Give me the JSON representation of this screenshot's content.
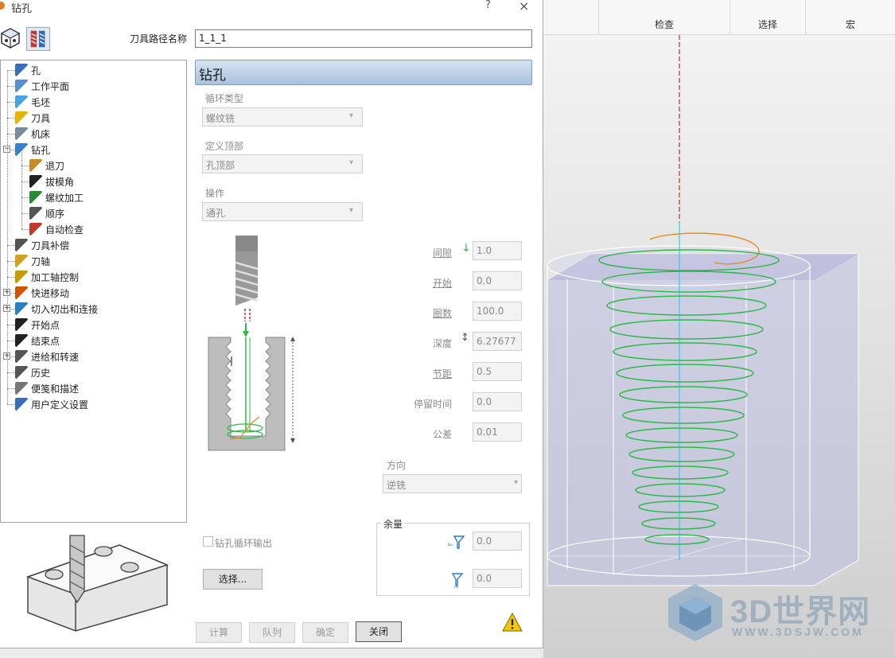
{
  "dialog": {
    "title": "钻孔",
    "help": "?",
    "close": "×",
    "path_label": "刀具路径名称",
    "path_value": "1_1_1"
  },
  "tree": [
    {
      "label": "孔",
      "icon": "hole-icon"
    },
    {
      "label": "工作平面",
      "icon": "workplane-icon"
    },
    {
      "label": "毛坯",
      "icon": "block-icon"
    },
    {
      "label": "刀具",
      "icon": "tool-icon"
    },
    {
      "label": "机床",
      "icon": "machine-icon"
    },
    {
      "label": "钻孔",
      "icon": "drill-icon"
    },
    {
      "label": "退刀",
      "icon": "retract-icon"
    },
    {
      "label": "拔模角",
      "icon": "draft-angle-icon"
    },
    {
      "label": "螺纹加工",
      "icon": "thread-icon"
    },
    {
      "label": "顺序",
      "icon": "order-icon"
    },
    {
      "label": "自动检查",
      "icon": "auto-check-icon"
    },
    {
      "label": "刀具补偿",
      "icon": "tool-comp-icon"
    },
    {
      "label": "刀轴",
      "icon": "tool-axis-icon"
    },
    {
      "label": "加工轴控制",
      "icon": "axis-control-icon"
    },
    {
      "label": "快进移动",
      "icon": "rapid-move-icon"
    },
    {
      "label": "切入切出和连接",
      "icon": "leads-links-icon"
    },
    {
      "label": "开始点",
      "icon": "start-point-icon"
    },
    {
      "label": "结束点",
      "icon": "end-point-icon"
    },
    {
      "label": "进给和转速",
      "icon": "feeds-speeds-icon"
    },
    {
      "label": "历史",
      "icon": "history-icon"
    },
    {
      "label": "便笺和描述",
      "icon": "notes-icon"
    },
    {
      "label": "用户定义设置",
      "icon": "user-settings-icon"
    }
  ],
  "section": {
    "title": "钻孔",
    "cycle_type_label": "循环类型",
    "cycle_type_value": "螺纹铣",
    "define_top_label": "定义顶部",
    "define_top_value": "孔顶部",
    "operation_label": "操作",
    "operation_value": "通孔"
  },
  "params": {
    "clearance_label": "间隙",
    "clearance_value": "1.0",
    "start_label": "开始",
    "start_value": "0.0",
    "turns_label": "圈数",
    "turns_value": "100.0",
    "depth_label": "深度",
    "depth_value": "6.27677",
    "pitch_label": "节距",
    "pitch_value": "0.5",
    "dwell_label": "停留时间",
    "dwell_value": "0.0",
    "tolerance_label": "公差",
    "tolerance_value": "0.01"
  },
  "direction": {
    "label": "方向",
    "value": "逆铣"
  },
  "stock": {
    "label": "余量",
    "radial": "0.0",
    "axial": "0.0"
  },
  "drill_cycle_output": "钻孔循环输出",
  "buttons": {
    "select": "选择...",
    "calculate": "计算",
    "queue": "队列",
    "ok": "确定",
    "close": "关闭"
  },
  "ribbon": {
    "groups": [
      "检查",
      "选择",
      "宏"
    ]
  },
  "watermark": {
    "text": "3D世界网",
    "url": "WWW.3DSJW.COM"
  },
  "colors": {
    "header_bg": "#a9c1de",
    "helix": "#2fb84a",
    "retract": "#e58a1c",
    "axis": "#2ad0e0",
    "warning": "#f5c800"
  }
}
